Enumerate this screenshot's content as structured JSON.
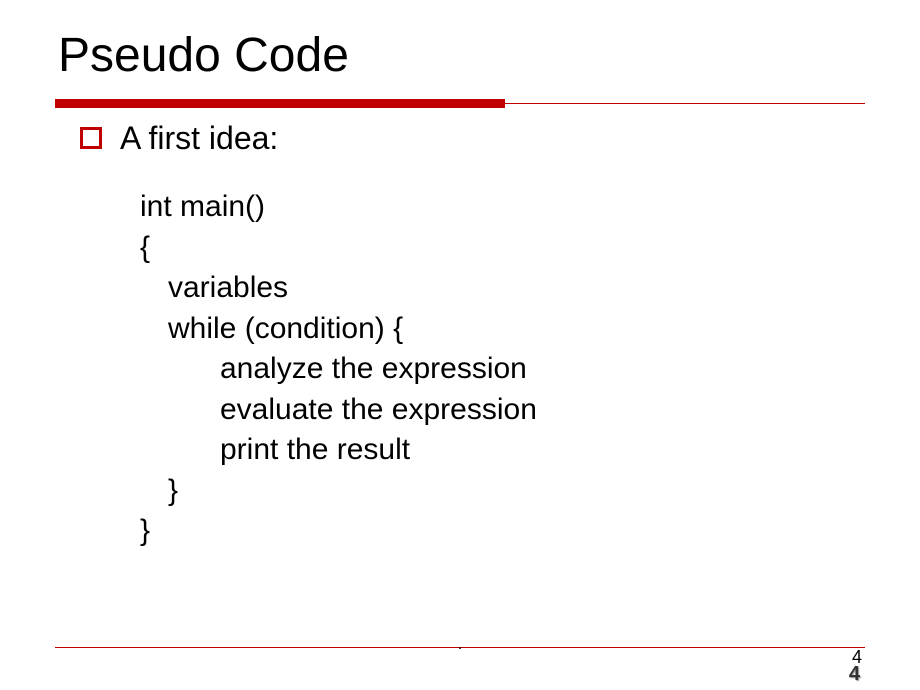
{
  "title": "Pseudo Code",
  "bullet": {
    "text": "A first idea:"
  },
  "code": {
    "line1": "int main()",
    "line2": "{",
    "line3": "variables",
    "line4": "while (condition) {",
    "line5": "analyze the expression",
    "line6": "evaluate the expression",
    "line7": "print the result",
    "line8": "}",
    "line9": "}"
  },
  "footer": {
    "dot": ".",
    "page_top": "4",
    "page_bottom": "4"
  }
}
